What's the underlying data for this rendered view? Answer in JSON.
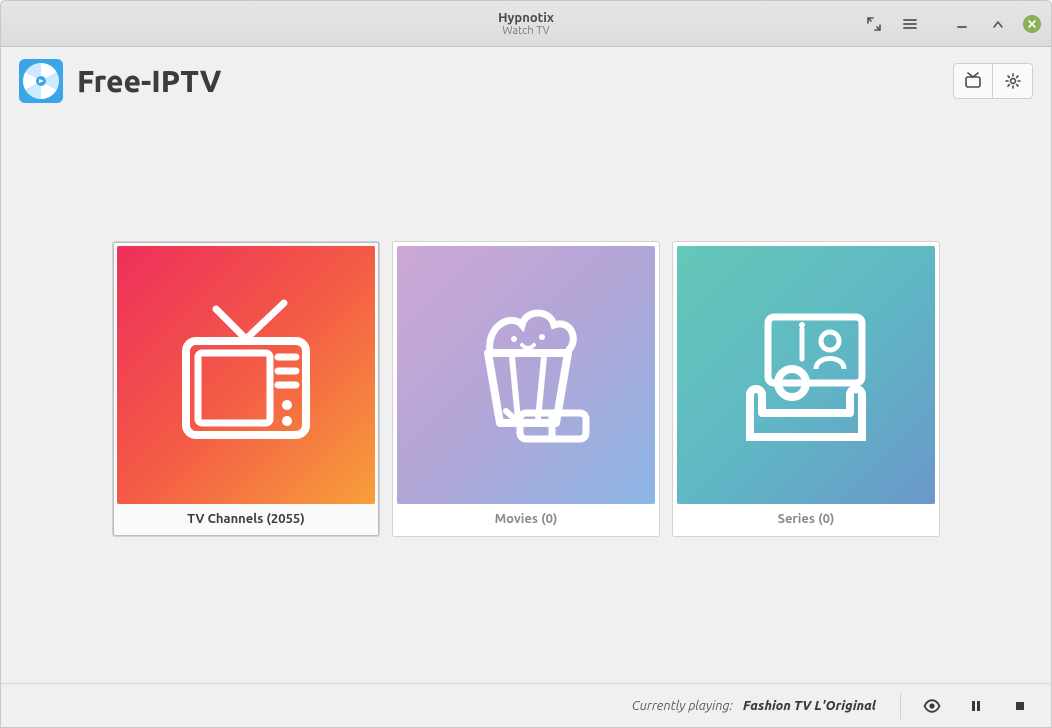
{
  "window": {
    "title": "Hypnotix",
    "subtitle": "Watch TV"
  },
  "header": {
    "provider_name": "Free-IPTV",
    "icons": {
      "providers": "providers",
      "preferences": "preferences"
    }
  },
  "categories": [
    {
      "id": "tv",
      "label": "TV Channels (2055)",
      "selected": true
    },
    {
      "id": "movies",
      "label": "Movies (0)",
      "selected": false
    },
    {
      "id": "series",
      "label": "Series (0)",
      "selected": false
    }
  ],
  "playback": {
    "label": "Currently playing:",
    "title": "Fashion TV L'Original"
  }
}
